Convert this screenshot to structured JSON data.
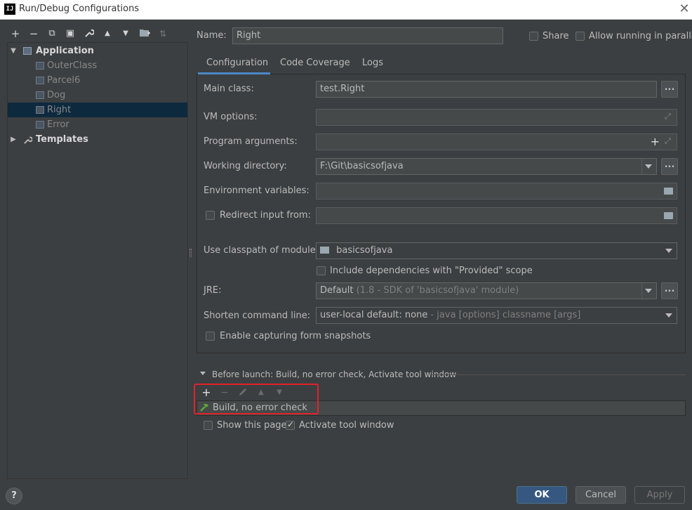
{
  "window": {
    "title": "Run/Debug Configurations",
    "app_icon": "IJ",
    "close_icon": "✕"
  },
  "toolbar": {
    "icons": [
      "add-icon",
      "remove-icon",
      "copy-icon",
      "save-icon",
      "wrench-icon",
      "move-up-icon",
      "move-down-icon",
      "new-folder-icon",
      "sort-icon"
    ],
    "glyphs": {
      "add": "+",
      "remove": "−",
      "copy": "⧉",
      "save": "▣",
      "wrench": "🔧",
      "up": "▲",
      "down": "▼",
      "folder": "▆",
      "sort": "⇅"
    }
  },
  "tree": {
    "application": "Application",
    "items": [
      "OuterClass",
      "Parcel6",
      "Dog",
      "Right",
      "Error"
    ],
    "selected": "Right",
    "templates": "Templates"
  },
  "name_row": {
    "label": "Name:",
    "value": "Right",
    "share": "Share",
    "allow_parallel": "Allow running in parallel"
  },
  "tabs": [
    "Configuration",
    "Code Coverage",
    "Logs"
  ],
  "config": {
    "main_class_label": "Main class:",
    "main_class": "test.Right",
    "vm_options_label": "VM options:",
    "program_args_label": "Program arguments:",
    "working_dir_label": "Working directory:",
    "working_dir": "F:\\Git\\basicsofjava",
    "env_vars_label": "Environment variables:",
    "redirect_label": "Redirect input from:",
    "classpath_label": "Use classpath of module:",
    "classpath_value": "basicsofjava",
    "include_deps": "Include dependencies with \"Provided\" scope",
    "jre_label": "JRE:",
    "jre_value": "Default",
    "jre_detail": "(1.8 - SDK of 'basicsofjava' module)",
    "shorten_label": "Shorten command line:",
    "shorten_value": "user-local default: none",
    "shorten_detail": "- java [options] classname [args]",
    "capture_snapshots": "Enable capturing form snapshots",
    "dots": "..."
  },
  "before_launch": {
    "header": "Before launch: Build, no error check, Activate tool window",
    "task": "Build, no error check",
    "show_page": "Show this page",
    "activate_tool": "Activate tool window",
    "show_page_checked": false,
    "activate_tool_checked": true
  },
  "buttons": {
    "ok": "OK",
    "cancel": "Cancel",
    "apply": "Apply",
    "help": "?"
  },
  "colors": {
    "background": "#3c3f41",
    "selection": "#0d293e",
    "accent": "#4a88c7",
    "highlight": "#e0232a"
  }
}
